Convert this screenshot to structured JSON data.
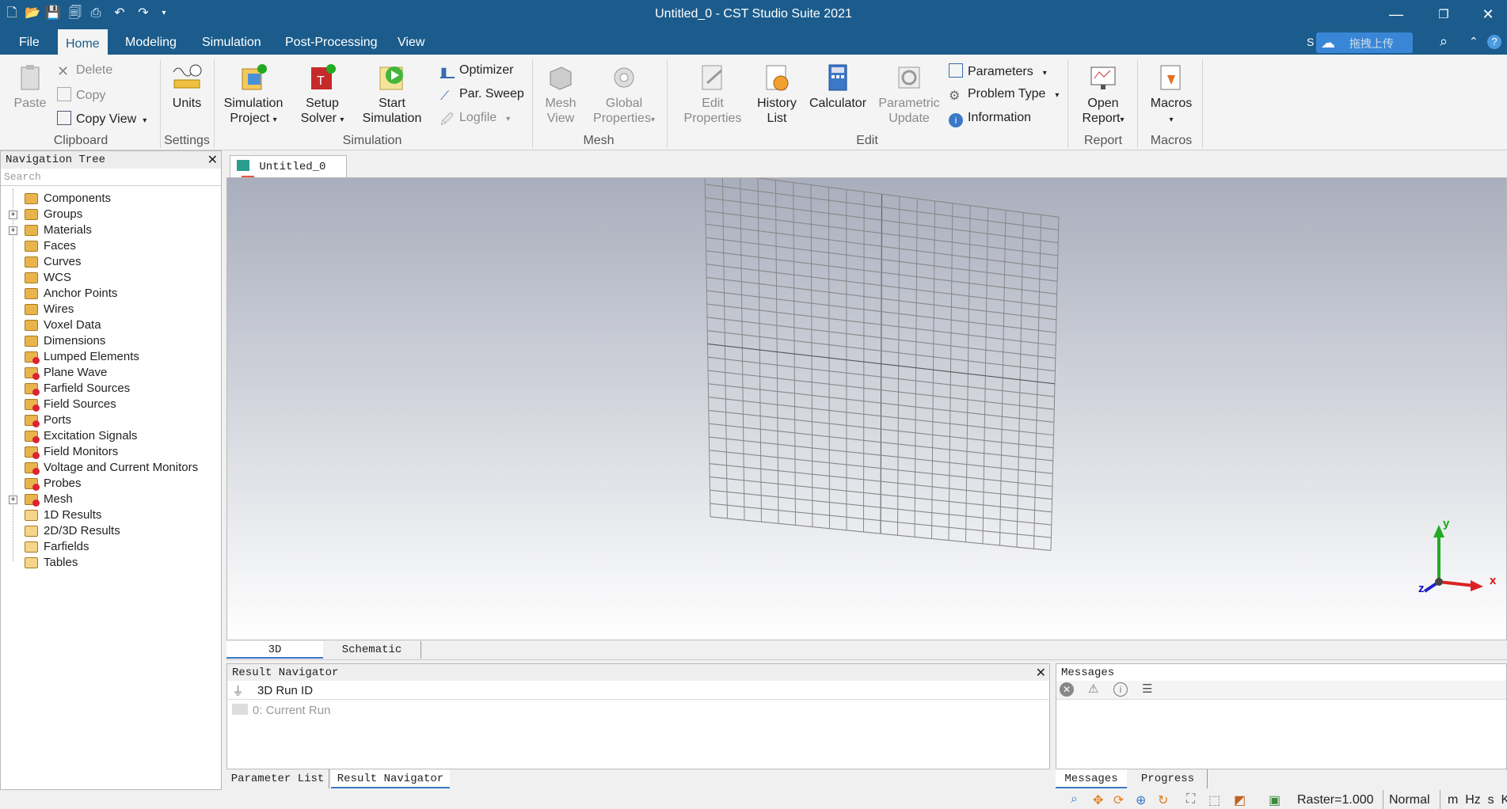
{
  "window": {
    "title": "Untitled_0 - CST Studio Suite 2021",
    "minimize": "—",
    "restore": "❐",
    "close": "✕"
  },
  "quick_access": [
    "new-file-icon",
    "open-folder-icon",
    "save-icon",
    "save-all-icon",
    "print-icon",
    "undo-icon",
    "redo-icon",
    "customize-icon"
  ],
  "menu": {
    "tabs": [
      "File",
      "Home",
      "Modeling",
      "Simulation",
      "Post-Processing",
      "View"
    ],
    "active": "Home",
    "cloud_label": "拖拽上传",
    "cloud_prefix": "S"
  },
  "ribbon": {
    "clipboard": {
      "paste": "Paste",
      "delete": "Delete",
      "copy": "Copy",
      "copy_view": "Copy View",
      "group": "Clipboard"
    },
    "settings": {
      "units": "Units",
      "group": "Settings"
    },
    "simulation": {
      "project_1": "Simulation",
      "project_2": "Project",
      "setup_1": "Setup",
      "setup_2": "Solver",
      "start_1": "Start",
      "start_2": "Simulation",
      "optimizer": "Optimizer",
      "par_sweep": "Par. Sweep",
      "logfile": "Logfile",
      "group": "Simulation"
    },
    "mesh": {
      "view_1": "Mesh",
      "view_2": "View",
      "global_1": "Global",
      "global_2": "Properties",
      "group": "Mesh"
    },
    "edit": {
      "props_1": "Edit",
      "props_2": "Properties",
      "history_1": "History",
      "history_2": "List",
      "calculator": "Calculator",
      "param_1": "Parametric",
      "param_2": "Update",
      "parameters": "Parameters",
      "problem_type": "Problem Type",
      "information": "Information",
      "group": "Edit"
    },
    "report": {
      "open_1": "Open",
      "open_2": "Report",
      "group": "Report"
    },
    "macros": {
      "label": "Macros",
      "group": "Macros"
    }
  },
  "nav_tree": {
    "title": "Navigation Tree",
    "search_placeholder": "Search",
    "items": [
      {
        "label": "Components",
        "expandable": false,
        "icon": "folder"
      },
      {
        "label": "Groups",
        "expandable": true,
        "icon": "folder"
      },
      {
        "label": "Materials",
        "expandable": true,
        "icon": "folder"
      },
      {
        "label": "Faces",
        "expandable": false,
        "icon": "folder"
      },
      {
        "label": "Curves",
        "expandable": false,
        "icon": "folder"
      },
      {
        "label": "WCS",
        "expandable": false,
        "icon": "folder"
      },
      {
        "label": "Anchor Points",
        "expandable": false,
        "icon": "folder"
      },
      {
        "label": "Wires",
        "expandable": false,
        "icon": "folder"
      },
      {
        "label": "Voxel Data",
        "expandable": false,
        "icon": "folder"
      },
      {
        "label": "Dimensions",
        "expandable": false,
        "icon": "folder"
      },
      {
        "label": "Lumped Elements",
        "expandable": false,
        "icon": "folder-red"
      },
      {
        "label": "Plane Wave",
        "expandable": false,
        "icon": "folder-red"
      },
      {
        "label": "Farfield Sources",
        "expandable": false,
        "icon": "folder-red"
      },
      {
        "label": "Field Sources",
        "expandable": false,
        "icon": "folder-red"
      },
      {
        "label": "Ports",
        "expandable": false,
        "icon": "folder-red"
      },
      {
        "label": "Excitation Signals",
        "expandable": false,
        "icon": "folder-red"
      },
      {
        "label": "Field Monitors",
        "expandable": false,
        "icon": "folder-red"
      },
      {
        "label": "Voltage and Current Monitors",
        "expandable": false,
        "icon": "folder-red"
      },
      {
        "label": "Probes",
        "expandable": false,
        "icon": "folder-red"
      },
      {
        "label": "Mesh",
        "expandable": true,
        "icon": "folder-red"
      },
      {
        "label": "1D Results",
        "expandable": false,
        "icon": "folder-res"
      },
      {
        "label": "2D/3D Results",
        "expandable": false,
        "icon": "folder-res"
      },
      {
        "label": "Farfields",
        "expandable": false,
        "icon": "folder-res"
      },
      {
        "label": "Tables",
        "expandable": false,
        "icon": "folder-res"
      }
    ]
  },
  "document": {
    "tab_label": "Untitled_0"
  },
  "view_tabs": {
    "tab_3d": "3D",
    "tab_schematic": "Schematic"
  },
  "axes": {
    "x": "x",
    "y": "y",
    "z": "z"
  },
  "result_navigator": {
    "title": "Result Navigator",
    "header": "3D Run ID",
    "row": "0: Current Run"
  },
  "messages": {
    "title": "Messages"
  },
  "bottom_tabs_left": {
    "parameter_list": "Parameter List",
    "result_navigator": "Result Navigator"
  },
  "bottom_tabs_right": {
    "messages": "Messages",
    "progress": "Progress"
  },
  "status": {
    "raster": "Raster=1.000",
    "mode": "Normal",
    "units": "m  Hz  s  K"
  }
}
